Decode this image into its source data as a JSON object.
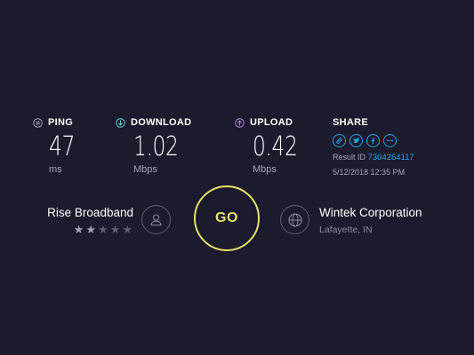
{
  "metrics": {
    "ping": {
      "title": "PING",
      "value": "47",
      "unit": "ms",
      "icon": "ping-icon",
      "color": "#a5a5b8"
    },
    "download": {
      "title": "DOWNLOAD",
      "value": "1.02",
      "unit": "Mbps",
      "icon": "download-arrow-icon",
      "color": "#5fd6d2"
    },
    "upload": {
      "title": "UPLOAD",
      "value": "0.42",
      "unit": "Mbps",
      "icon": "upload-arrow-icon",
      "color": "#b983e6"
    }
  },
  "share": {
    "title": "SHARE",
    "buttons": [
      "link-icon",
      "twitter-icon",
      "facebook-icon",
      "more-icon"
    ],
    "result_label": "Result ID",
    "result_id": "7304264117",
    "date": "5/12/2018 12:35 PM"
  },
  "isp": {
    "name": "Rise Broadband",
    "rating": 2,
    "rating_max": 5,
    "icon": "user-icon"
  },
  "go": {
    "label": "GO"
  },
  "server": {
    "name": "Wintek Corporation",
    "location": "Lafayette, IN",
    "icon": "globe-icon"
  },
  "colors": {
    "background": "#1b1b2d",
    "accent_blue": "#1fa4e8",
    "go_yellow": "#e7e06a"
  }
}
